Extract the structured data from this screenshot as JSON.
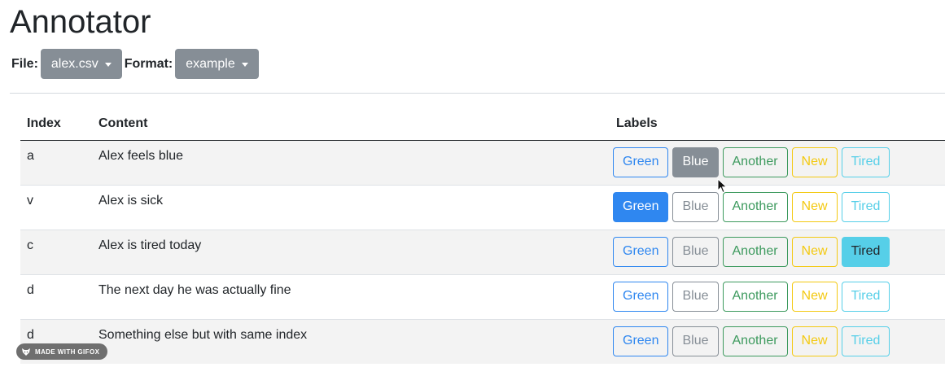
{
  "title": "Annotator",
  "controls": {
    "file_label": "File:",
    "file_value": "alex.csv",
    "format_label": "Format:",
    "format_value": "example"
  },
  "table": {
    "headers": {
      "index": "Index",
      "content": "Content",
      "labels": "Labels"
    },
    "label_names": [
      "Green",
      "Blue",
      "Another",
      "New",
      "Tired"
    ],
    "rows": [
      {
        "index": "a",
        "content": "Alex feels blue",
        "selected": "Blue"
      },
      {
        "index": "v",
        "content": "Alex is sick",
        "selected": "Green"
      },
      {
        "index": "c",
        "content": "Alex is tired today",
        "selected": "Tired"
      },
      {
        "index": "d",
        "content": "The next day he was actually fine",
        "selected": ""
      },
      {
        "index": "d",
        "content": "Something else but with same index",
        "selected": ""
      }
    ]
  },
  "colors": {
    "green": "#2f87f0",
    "blue": "#868e96",
    "another": "#3d9a5e",
    "new": "#f3c911",
    "tired": "#56cfe8"
  },
  "watermark": "MADE WITH GIFOX"
}
